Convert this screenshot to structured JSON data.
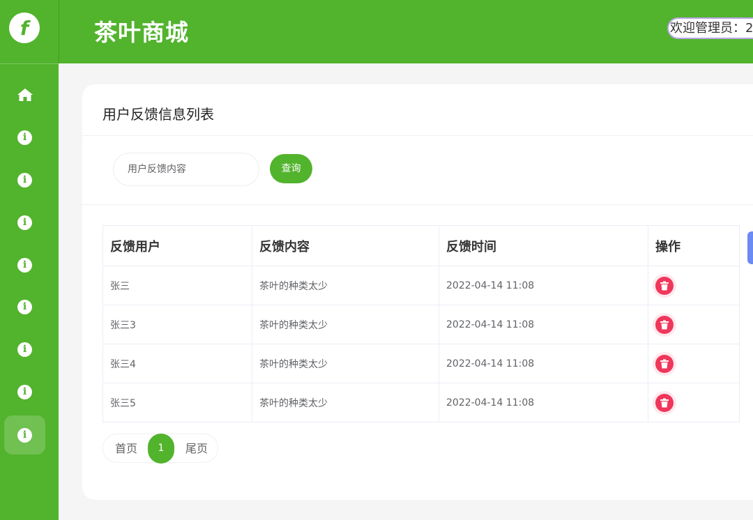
{
  "logo": {
    "letter": "f"
  },
  "header": {
    "title": "茶叶商城",
    "welcome": "欢迎管理员：2"
  },
  "sidebar": {
    "items": [
      {
        "icon": "home-icon",
        "active": false
      },
      {
        "icon": "info-icon",
        "active": false
      },
      {
        "icon": "info-icon",
        "active": false
      },
      {
        "icon": "info-icon",
        "active": false
      },
      {
        "icon": "info-icon",
        "active": false
      },
      {
        "icon": "info-icon",
        "active": false
      },
      {
        "icon": "info-icon",
        "active": false
      },
      {
        "icon": "info-icon",
        "active": false
      },
      {
        "icon": "info-icon",
        "active": true
      }
    ]
  },
  "page": {
    "title": "用户反馈信息列表"
  },
  "search": {
    "placeholder": "用户反馈内容",
    "value": "",
    "button_label": "查询"
  },
  "table": {
    "headers": [
      "反馈用户",
      "反馈内容",
      "反馈时间",
      "操作"
    ],
    "rows": [
      {
        "user": "张三",
        "content": "茶叶的种类太少",
        "time": "2022-04-14 11:08"
      },
      {
        "user": "张三3",
        "content": "茶叶的种类太少",
        "time": "2022-04-14 11:08"
      },
      {
        "user": "张三4",
        "content": "茶叶的种类太少",
        "time": "2022-04-14 11:08"
      },
      {
        "user": "张三5",
        "content": "茶叶的种类太少",
        "time": "2022-04-14 11:08"
      }
    ]
  },
  "pagination": {
    "first": "首页",
    "current": "1",
    "last": "尾页"
  },
  "colors": {
    "brand": "#52b32d",
    "delete": "#f0365b"
  }
}
